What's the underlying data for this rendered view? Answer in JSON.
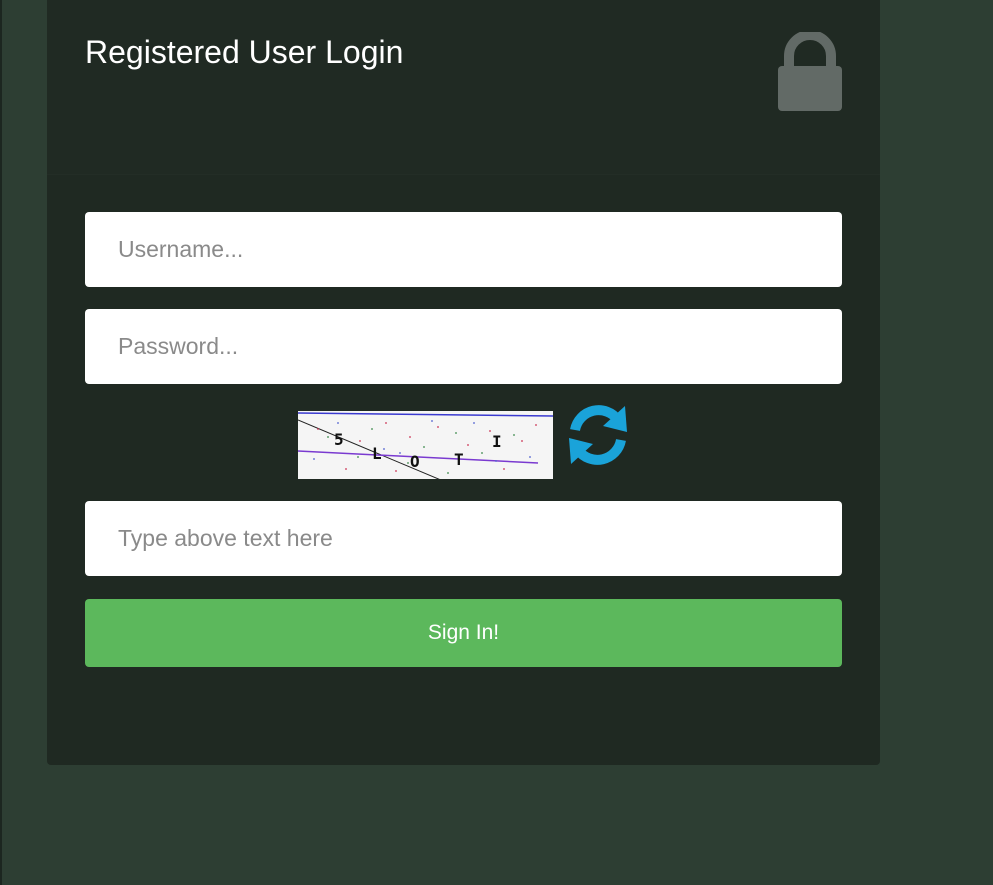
{
  "login": {
    "title": "Registered User Login",
    "username_placeholder": "Username...",
    "password_placeholder": "Password...",
    "captcha_text": "5LOTI",
    "captcha_input_placeholder": "Type above text here",
    "signin_label": "Sign In!"
  },
  "icons": {
    "lock": "lock-icon",
    "refresh": "refresh-icon"
  },
  "colors": {
    "page_background": "#2d3e33",
    "card_background": "#1f2922",
    "lock_icon": "#626a66",
    "refresh_icon": "#1aa3d9",
    "signin_button": "#5cb85c"
  }
}
